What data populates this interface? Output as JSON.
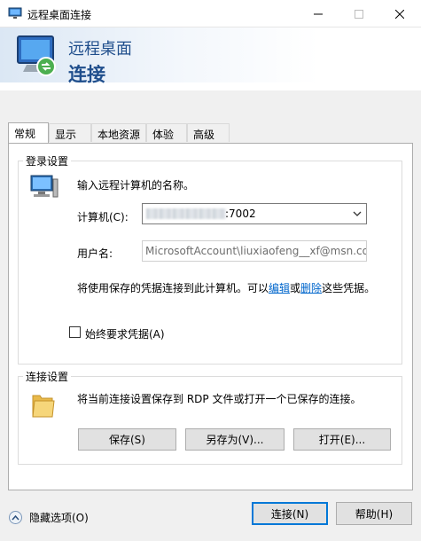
{
  "window": {
    "title": "远程桌面连接"
  },
  "header": {
    "line1": "远程桌面",
    "line2": "连接"
  },
  "tabs": [
    {
      "label": "常规",
      "active": true
    },
    {
      "label": "显示",
      "active": false
    },
    {
      "label": "本地资源",
      "active": false
    },
    {
      "label": "体验",
      "active": false
    },
    {
      "label": "高级",
      "active": false
    }
  ],
  "login": {
    "group_title": "登录设置",
    "prompt": "输入远程计算机的名称。",
    "computer_label": "计算机(C):",
    "computer_value_visible": ":7002",
    "username_label": "用户名:",
    "username_value": "MicrosoftAccount\\liuxiaofeng__xf@msn.cor",
    "notice_prefix": "将使用保存的凭据连接到此计算机。可以",
    "edit_link": "编辑",
    "notice_or": "或",
    "delete_link": "删除",
    "notice_suffix": "这些凭据。",
    "always_ask_label": "始终要求凭据(A)",
    "always_ask_checked": false
  },
  "connection": {
    "group_title": "连接设置",
    "description": "将当前连接设置保存到 RDP 文件或打开一个已保存的连接。",
    "save_label": "保存(S)",
    "save_as_label": "另存为(V)...",
    "open_label": "打开(E)..."
  },
  "footer": {
    "hide_options_label": "隐藏选项(O)",
    "connect_label": "连接(N)",
    "help_label": "帮助(H)"
  },
  "colors": {
    "accent": "#0078d7",
    "header_text": "#1f4e8c",
    "link": "#0066cc"
  }
}
